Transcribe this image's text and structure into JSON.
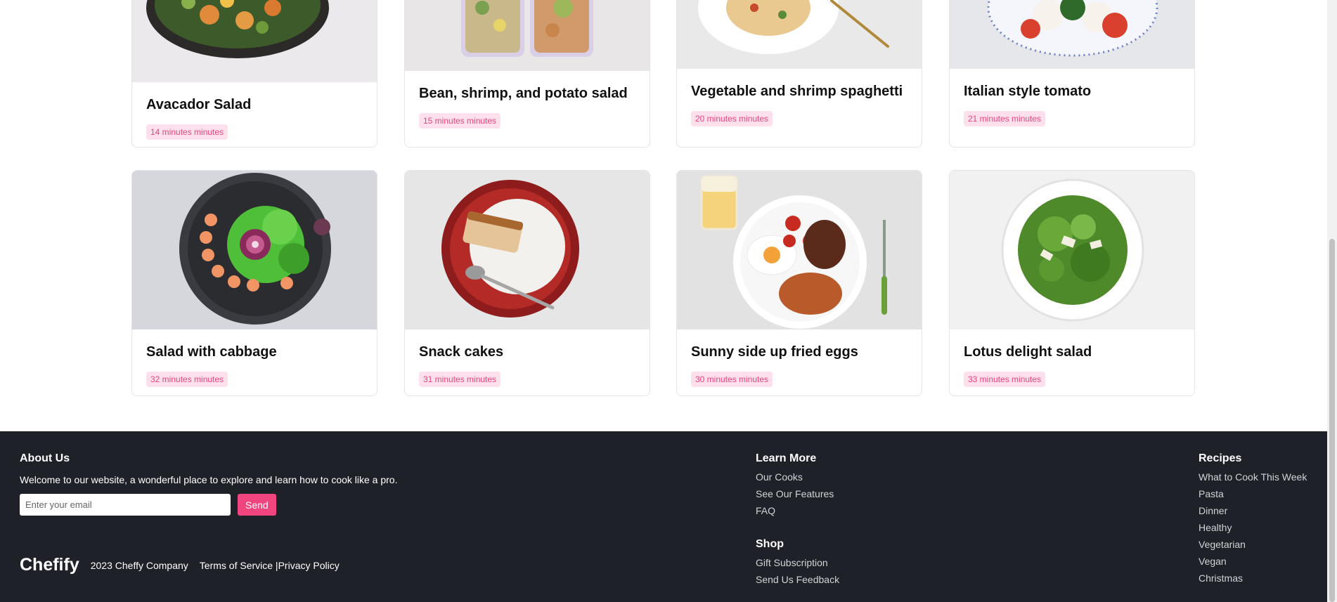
{
  "recipes_row1": [
    {
      "title": "Avacador Salad",
      "time": "14 minutes minutes"
    },
    {
      "title": "Bean, shrimp, and potato salad",
      "time": "15 minutes minutes"
    },
    {
      "title": "Vegetable and shrimp spaghetti",
      "time": "20 minutes minutes"
    },
    {
      "title": "Italian style tomato",
      "time": "21 minutes minutes"
    }
  ],
  "recipes_row2": [
    {
      "title": "Salad with cabbage",
      "time": "32 minutes minutes"
    },
    {
      "title": "Snack cakes",
      "time": "31 minutes minutes"
    },
    {
      "title": "Sunny side up fried eggs",
      "time": "30 minutes minutes"
    },
    {
      "title": "Lotus delight salad",
      "time": "33 minutes minutes"
    }
  ],
  "footer": {
    "about": {
      "heading": "About Us",
      "text": "Welcome to our website, a wonderful place to explore and learn how to cook like a pro.",
      "email_placeholder": "Enter your email",
      "send_label": "Send"
    },
    "brand": "Chefify",
    "copyright": "2023 Cheffy Company",
    "terms": "Terms of Service |",
    "privacy": "Privacy Policy",
    "learn_more": {
      "heading": "Learn More",
      "links": [
        "Our Cooks",
        "See Our Features",
        "FAQ"
      ]
    },
    "shop": {
      "heading": "Shop",
      "links": [
        "Gift Subscription",
        "Send Us Feedback"
      ]
    },
    "recipes": {
      "heading": "Recipes",
      "links": [
        "What to Cook This Week",
        "Pasta",
        "Dinner",
        "Healthy",
        "Vegetarian",
        "Vegan",
        "Christmas"
      ]
    }
  },
  "colors": {
    "accent": "#f0457f",
    "badge_bg": "#fde0ec",
    "badge_text": "#e8457f",
    "footer_bg": "#1e2128"
  }
}
